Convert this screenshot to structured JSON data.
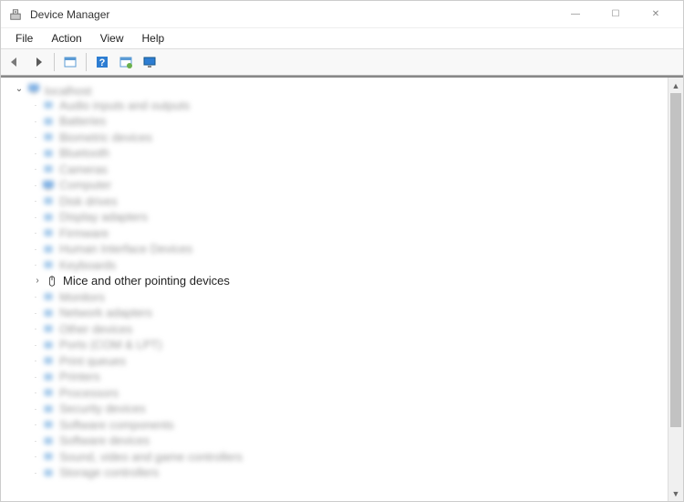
{
  "window": {
    "title": "Device Manager",
    "controls": {
      "min": "—",
      "max": "☐",
      "close": "✕"
    }
  },
  "menu": {
    "items": [
      "File",
      "Action",
      "View",
      "Help"
    ]
  },
  "toolbar": {
    "back": "back-icon",
    "forward": "forward-icon",
    "show_hidden": "show-hidden-icon",
    "help": "help-icon",
    "refresh": "refresh-icon",
    "monitor": "monitor-icon"
  },
  "tree": {
    "root": {
      "expanded": true,
      "label": "localhost",
      "icon": "computer"
    },
    "focused_index": 12,
    "children": [
      {
        "label": "Audio inputs and outputs",
        "icon": "audio",
        "blurred": true
      },
      {
        "label": "Batteries",
        "icon": "battery",
        "blurred": true
      },
      {
        "label": "Biometric devices",
        "icon": "biometric",
        "blurred": true
      },
      {
        "label": "Bluetooth",
        "icon": "bluetooth",
        "blurred": true
      },
      {
        "label": "Cameras",
        "icon": "camera",
        "blurred": true
      },
      {
        "label": "Computer",
        "icon": "computer",
        "blurred": true
      },
      {
        "label": "Disk drives",
        "icon": "disk",
        "blurred": true
      },
      {
        "label": "Display adapters",
        "icon": "display",
        "blurred": true
      },
      {
        "label": "Firmware",
        "icon": "firmware",
        "blurred": true
      },
      {
        "label": "Human Interface Devices",
        "icon": "hid",
        "blurred": true
      },
      {
        "label": "Keyboards",
        "icon": "keyboard",
        "blurred": true
      },
      {
        "label": "Mice and other pointing devices",
        "icon": "mouse",
        "blurred": false,
        "collapsed_chevron": true
      },
      {
        "label": "Monitors",
        "icon": "monitor",
        "blurred": true
      },
      {
        "label": "Network adapters",
        "icon": "network",
        "blurred": true
      },
      {
        "label": "Other devices",
        "icon": "other",
        "blurred": true
      },
      {
        "label": "Ports (COM & LPT)",
        "icon": "port",
        "blurred": true
      },
      {
        "label": "Print queues",
        "icon": "printer",
        "blurred": true
      },
      {
        "label": "Printers",
        "icon": "printer",
        "blurred": true
      },
      {
        "label": "Processors",
        "icon": "cpu",
        "blurred": true
      },
      {
        "label": "Security devices",
        "icon": "security",
        "blurred": true
      },
      {
        "label": "Software components",
        "icon": "software",
        "blurred": true
      },
      {
        "label": "Software devices",
        "icon": "software",
        "blurred": true
      },
      {
        "label": "Sound, video and game controllers",
        "icon": "sound",
        "blurred": true
      },
      {
        "label": "Storage controllers",
        "icon": "storage",
        "blurred": true
      }
    ]
  },
  "colors": {
    "accent": "#2d7dd2",
    "blur_text": "#8a8a8a"
  }
}
